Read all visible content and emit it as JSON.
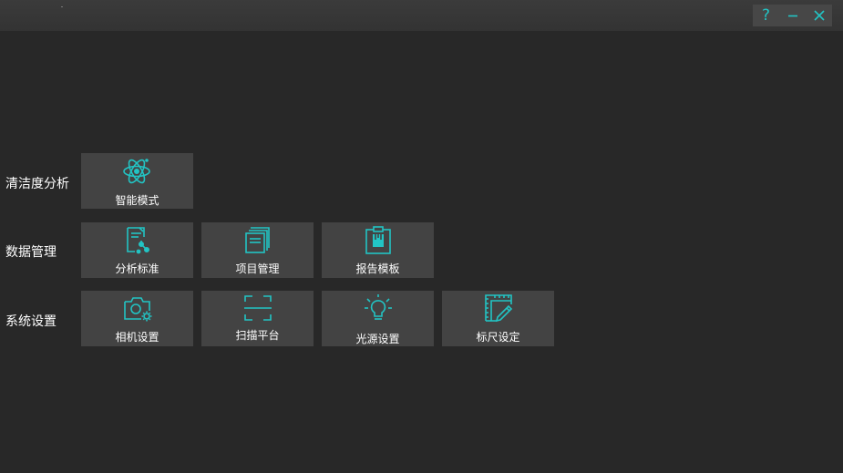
{
  "window": {
    "controls": [
      {
        "name": "help",
        "icon": "question-mark-icon",
        "glyph": "?"
      },
      {
        "name": "minimize",
        "icon": "minimize-icon"
      },
      {
        "name": "close",
        "icon": "close-icon"
      }
    ],
    "accent_color": "#22c4c4"
  },
  "groups": [
    {
      "label": "清洁度分析",
      "tiles": [
        {
          "label": "智能模式",
          "icon": "atom-icon"
        }
      ]
    },
    {
      "label": "数据管理",
      "tiles": [
        {
          "label": "分析标准",
          "icon": "document-chart-icon"
        },
        {
          "label": "项目管理",
          "icon": "stacked-documents-icon"
        },
        {
          "label": "报告模板",
          "icon": "clipboard-icon"
        }
      ]
    },
    {
      "label": "系统设置",
      "tiles": [
        {
          "label": "相机设置",
          "icon": "camera-gear-icon"
        },
        {
          "label": "扫描平台",
          "icon": "scan-frame-icon"
        },
        {
          "label": "光源设置",
          "icon": "lightbulb-icon"
        },
        {
          "label": "标尺设定",
          "icon": "ruler-pencil-icon"
        }
      ]
    }
  ]
}
